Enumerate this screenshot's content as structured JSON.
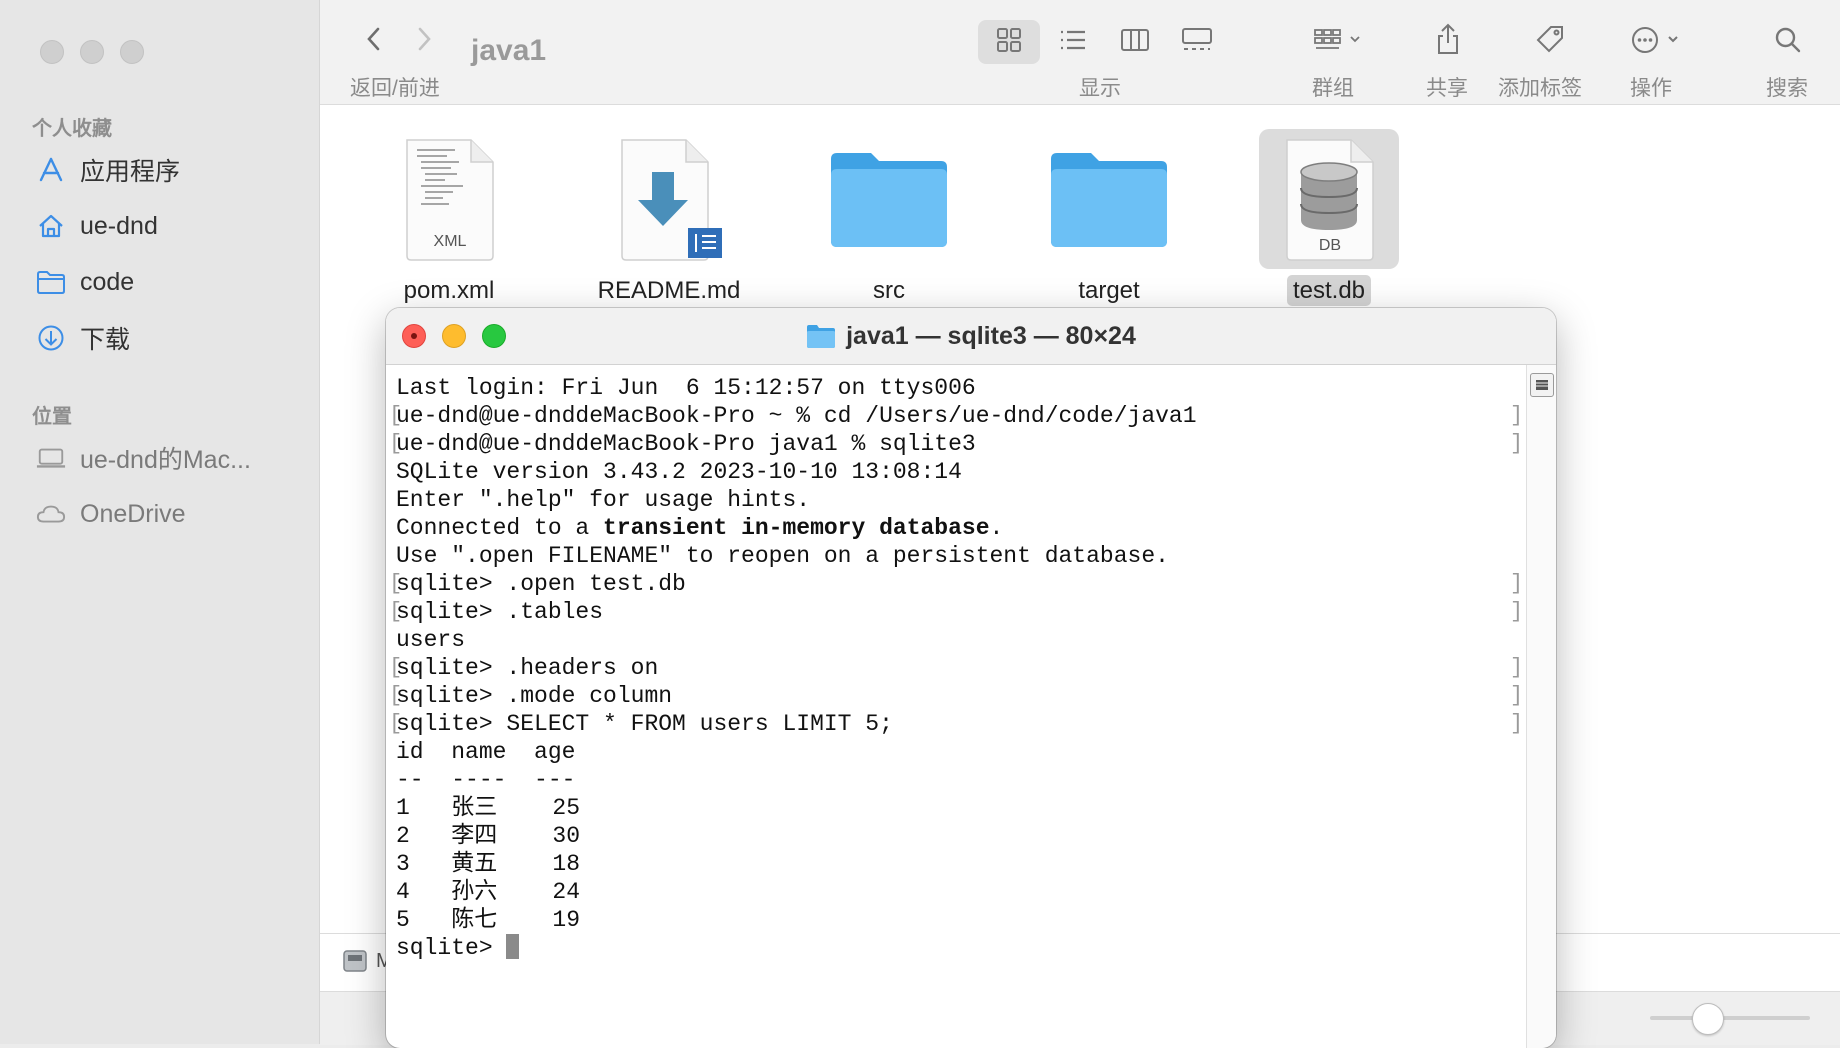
{
  "finder": {
    "window_title": "java1",
    "back_forward_label": "返回/前进",
    "view_label": "显示",
    "group_label": "群组",
    "share_label": "共享",
    "tags_label": "添加标签",
    "action_label": "操作",
    "search_label": "搜索",
    "sidebar": {
      "favorites_heading": "个人收藏",
      "favorites": [
        {
          "label": "应用程序",
          "icon": "applications-icon"
        },
        {
          "label": "ue-dnd",
          "icon": "home-icon"
        },
        {
          "label": "code",
          "icon": "folder-icon"
        },
        {
          "label": "下载",
          "icon": "downloads-icon"
        }
      ],
      "locations_heading": "位置",
      "locations": [
        {
          "label": "ue-dnd的Mac...",
          "icon": "laptop-icon"
        },
        {
          "label": "OneDrive",
          "icon": "cloud-icon"
        }
      ]
    },
    "files": [
      {
        "name": "pom.xml",
        "badge": "XML",
        "type": "xml"
      },
      {
        "name": "README.md",
        "type": "markdown"
      },
      {
        "name": "src",
        "type": "folder"
      },
      {
        "name": "target",
        "type": "folder"
      },
      {
        "name": "test.db",
        "badge": "DB",
        "type": "database",
        "selected": true
      }
    ],
    "pathbar_fragment": "M"
  },
  "terminal": {
    "title": "java1 — sqlite3 — 80×24",
    "lines": [
      "Last login: Fri Jun  6 15:12:57 on ttys006",
      "ue-dnd@ue-dnddeMacBook-Pro ~ % cd /Users/ue-dnd/code/java1",
      "ue-dnd@ue-dnddeMacBook-Pro java1 % sqlite3",
      "SQLite version 3.43.2 2023-10-10 13:08:14",
      "Enter \".help\" for usage hints.",
      "",
      "Use \".open FILENAME\" to reopen on a persistent database.",
      "sqlite> .open test.db",
      "sqlite> .tables",
      "users",
      "sqlite> .headers on",
      "sqlite> .mode column",
      "sqlite> SELECT * FROM users LIMIT 5;",
      "id  name  age",
      "--  ----  ---",
      "1   张三    25",
      "2   李四    30",
      "3   黄五    18",
      "4   孙六    24",
      "5   陈七    19",
      "sqlite> "
    ],
    "connected_prefix": "Connected to a ",
    "connected_bold": "transient in-memory database",
    "connected_suffix": "."
  }
}
